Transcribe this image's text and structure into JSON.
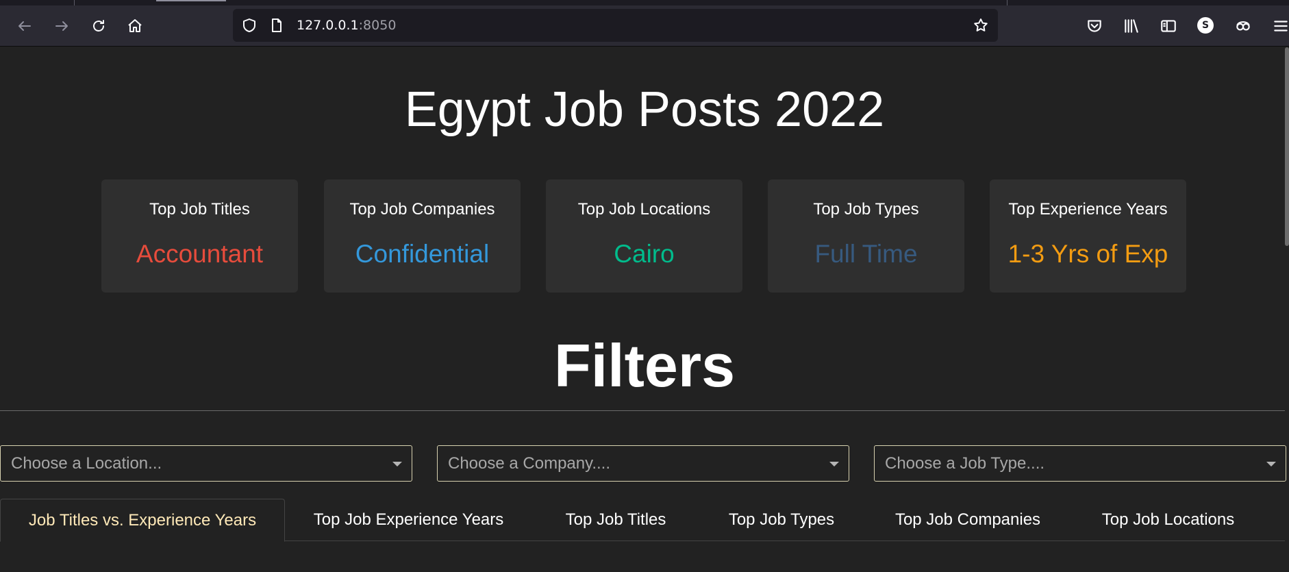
{
  "browser": {
    "url_host": "127.0.0.1",
    "url_port": ":8050",
    "profile_initial": "S",
    "icons": [
      "back-icon",
      "forward-icon",
      "reload-icon",
      "home-icon",
      "shield-icon",
      "page-icon",
      "bookmark-star-icon",
      "pocket-icon",
      "library-icon",
      "sidebar-icon",
      "account-icon",
      "extensions-icon",
      "menu-icon"
    ]
  },
  "page": {
    "title": "Egypt Job Posts 2022",
    "filters_title": "Filters"
  },
  "cards": [
    {
      "label": "Top Job Titles",
      "value": "Accountant",
      "color": "#e74c3c"
    },
    {
      "label": "Top Job Companies",
      "value": "Confidential",
      "color": "#3498db"
    },
    {
      "label": "Top Job Locations",
      "value": "Cairo",
      "color": "#00bc8c"
    },
    {
      "label": "Top Job Types",
      "value": "Full Time",
      "color": "#375a7f"
    },
    {
      "label": "Top Experience Years",
      "value": "1-3 Yrs of Exp",
      "color": "#f39c12"
    }
  ],
  "filters": {
    "location_placeholder": "Choose a Location...",
    "company_placeholder": "Choose a Company....",
    "job_type_placeholder": "Choose a Job Type...."
  },
  "tabs": [
    {
      "label": "Job Titles vs. Experience Years",
      "active": true
    },
    {
      "label": "Top Job Experience Years",
      "active": false
    },
    {
      "label": "Top Job Titles",
      "active": false
    },
    {
      "label": "Top Job Types",
      "active": false
    },
    {
      "label": "Top Job Companies",
      "active": false
    },
    {
      "label": "Top Job Locations",
      "active": false
    }
  ],
  "colors": {
    "background": "#222222",
    "card_background": "#2f2f2f",
    "active_tab_text": "#ffe9b8",
    "dropdown_border": "#d8d2b0"
  }
}
